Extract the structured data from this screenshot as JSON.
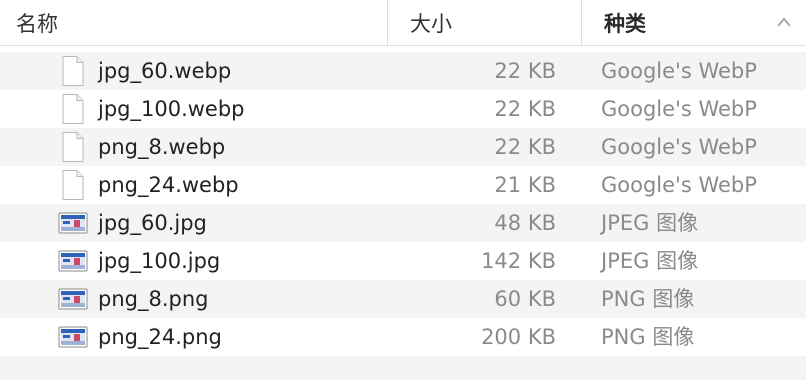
{
  "header": {
    "name_label": "名称",
    "size_label": "大小",
    "kind_label": "种类"
  },
  "files": [
    {
      "name": "jpg_60.webp",
      "size": "22 KB",
      "kind": "Google's WebP",
      "icon": "document-icon"
    },
    {
      "name": "jpg_100.webp",
      "size": "22 KB",
      "kind": "Google's WebP",
      "icon": "document-icon"
    },
    {
      "name": "png_8.webp",
      "size": "22 KB",
      "kind": "Google's WebP",
      "icon": "document-icon"
    },
    {
      "name": "png_24.webp",
      "size": "21 KB",
      "kind": "Google's WebP",
      "icon": "document-icon"
    },
    {
      "name": "jpg_60.jpg",
      "size": "48 KB",
      "kind": "JPEG 图像",
      "icon": "image-thumbnail-icon"
    },
    {
      "name": "jpg_100.jpg",
      "size": "142 KB",
      "kind": "JPEG 图像",
      "icon": "image-thumbnail-icon"
    },
    {
      "name": "png_8.png",
      "size": "60 KB",
      "kind": "PNG 图像",
      "icon": "image-thumbnail-icon"
    },
    {
      "name": "png_24.png",
      "size": "200 KB",
      "kind": "PNG 图像",
      "icon": "image-thumbnail-icon"
    }
  ]
}
